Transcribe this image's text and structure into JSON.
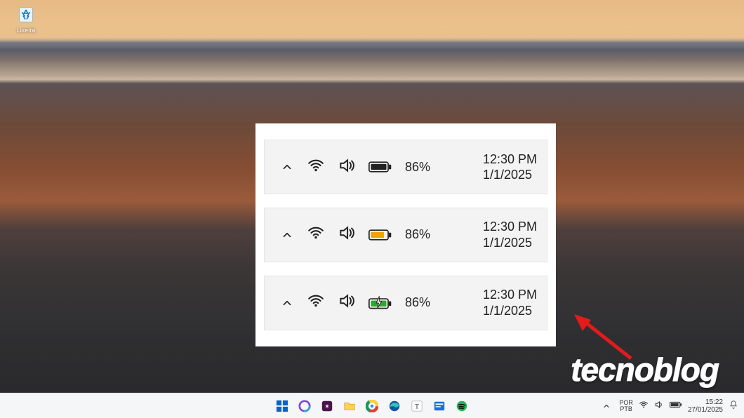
{
  "desktop": {
    "recycle_bin_label": "Lixeira"
  },
  "panel": {
    "rows": [
      {
        "battery_state": "full",
        "battery_pct": "86%",
        "time": "12:30 PM",
        "date": "1/1/2025"
      },
      {
        "battery_state": "low",
        "battery_pct": "86%",
        "time": "12:30 PM",
        "date": "1/1/2025"
      },
      {
        "battery_state": "charging",
        "battery_pct": "86%",
        "time": "12:30 PM",
        "date": "1/1/2025"
      }
    ]
  },
  "watermark": {
    "text": "tecnoblog"
  },
  "taskbar": {
    "language": {
      "line1": "POR",
      "line2": "PTB"
    },
    "clock": {
      "time": "15:22",
      "date": "27/01/2025"
    },
    "icons": [
      "start",
      "copilot",
      "search",
      "explorer",
      "chrome",
      "edge",
      "text",
      "mail",
      "spotify"
    ]
  }
}
